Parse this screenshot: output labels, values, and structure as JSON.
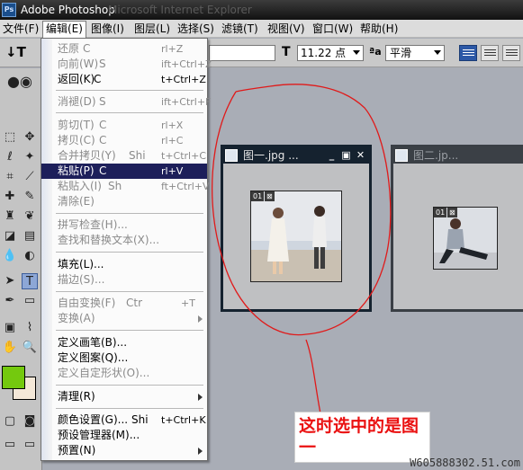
{
  "app": {
    "title": "Adobe Photoshop",
    "ghost_title": "Microsoft Internet Explorer",
    "icon_text": "Ps"
  },
  "menubar": [
    "文件(F)",
    "编辑(E)",
    "图像(I)",
    "图层(L)",
    "选择(S)",
    "滤镜(T)",
    "视图(V)",
    "窗口(W)",
    "帮助(H)"
  ],
  "options_bar": {
    "tool_glyph": "↓T",
    "font_size": "11.22 点",
    "aa_icon": "ªa",
    "anti_alias": "平滑"
  },
  "edit_menu": {
    "items": [
      {
        "label": "还原",
        "shortcut": "rl+Z"
      },
      {
        "label": "向前(W)",
        "shortcut": "ift+Ctrl+Z"
      },
      {
        "label": "返回(K)",
        "shortcut": "t+Ctrl+Z"
      },
      {
        "label": "消褪(D)",
        "shortcut": "ift+Ctrl+F"
      },
      {
        "label": "剪切(T)",
        "shortcut": "rl+X"
      },
      {
        "label": "拷贝(C)",
        "shortcut": "rl+C"
      },
      {
        "label": "合并拷贝(Y)",
        "shortcut": "t+Ctrl+C"
      },
      {
        "label": "粘贴(P)",
        "shortcut": "rl+V"
      },
      {
        "label": "粘贴入(I)",
        "shortcut": "ft+Ctrl+V"
      },
      {
        "label": "清除(E)",
        "shortcut": ""
      },
      {
        "label": "拼写检查(H)...",
        "shortcut": ""
      },
      {
        "label": "查找和替换文本(X)...",
        "shortcut": ""
      },
      {
        "label": "填充(L)...",
        "shortcut": ""
      },
      {
        "label": "描边(S)...",
        "shortcut": ""
      },
      {
        "label": "自由变换(F)",
        "shortcut": "+T"
      },
      {
        "label": "变换(A)",
        "shortcut": ""
      },
      {
        "label": "定义画笔(B)...",
        "shortcut": ""
      },
      {
        "label": "定义图案(Q)...",
        "shortcut": ""
      },
      {
        "label": "定义自定形状(O)...",
        "shortcut": ""
      },
      {
        "label": "清理(R)",
        "shortcut": ""
      },
      {
        "label": "颜色设置(G)...",
        "shortcut": "t+Ctrl+K"
      },
      {
        "label": "预设管理器(M)...",
        "shortcut": ""
      },
      {
        "label": "预置(N)",
        "shortcut": ""
      }
    ],
    "fragments": {
      "shi": "Shi",
      "ctr": "Ctr",
      "sh": "Sh",
      "c": "C",
      "s": "S"
    }
  },
  "documents": [
    {
      "title": "图一.jpg ...",
      "badge_left": "01",
      "badge_right": "⊠"
    },
    {
      "title": "图二.jp...",
      "badge_left": "01",
      "badge_right": "⊠"
    }
  ],
  "annotation": "这时选中的是图一",
  "watermark": "W605888302.51.com",
  "colors": {
    "foreground": "#74c90e",
    "background": "#f4e8d8",
    "annotation": "#ea1111",
    "highlight": "#1d1f5a"
  }
}
